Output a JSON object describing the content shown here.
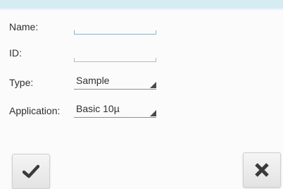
{
  "form": {
    "name": {
      "label": "Name:",
      "value": ""
    },
    "id": {
      "label": "ID:",
      "value": ""
    },
    "type": {
      "label": "Type:",
      "selected": "Sample"
    },
    "application": {
      "label": "Application:",
      "selected": "Basic 10µ"
    }
  },
  "buttons": {
    "confirm": {
      "icon": "checkmark-icon"
    },
    "cancel": {
      "icon": "close-icon"
    }
  },
  "colors": {
    "top_band": "#d4ecf2",
    "focus_underline": "#7fb8d4",
    "icon": "#3a3a3a"
  }
}
